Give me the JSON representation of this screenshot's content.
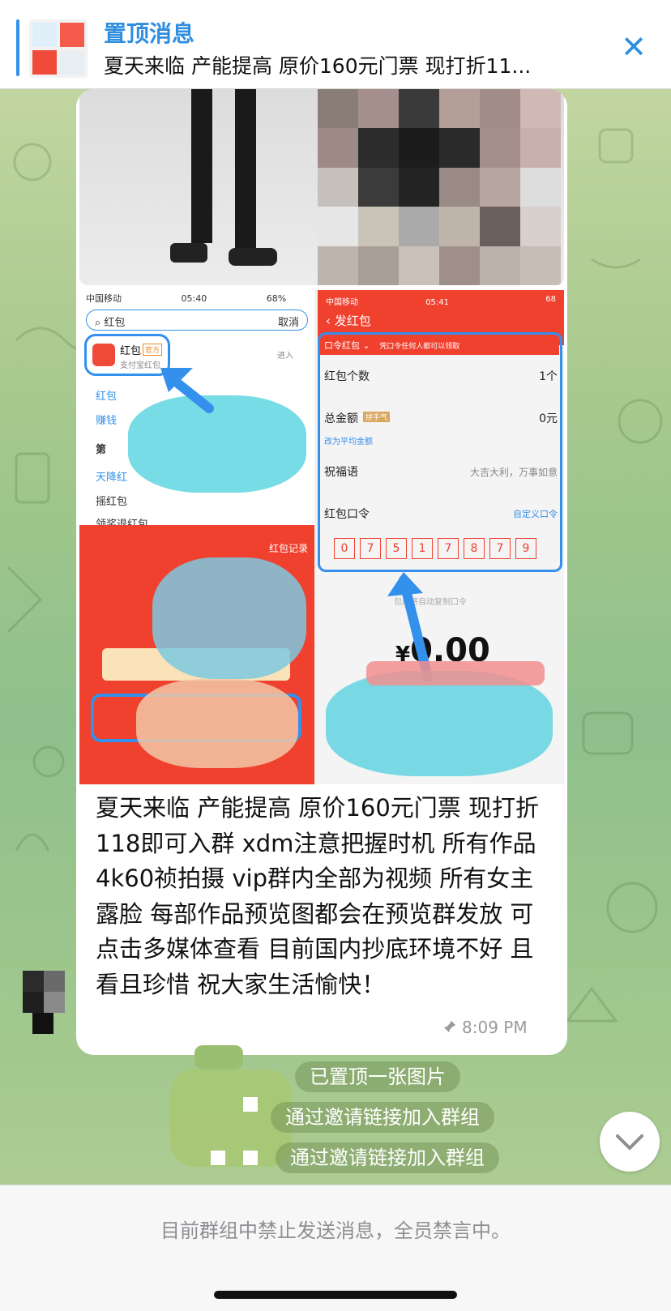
{
  "pinned": {
    "title": "置顶消息",
    "text": "夏天来临 产能提高 原价160元门票 现打折11..."
  },
  "icons": {
    "close": "close-icon",
    "pin": "pin-icon",
    "scroll_down": "chevron-down-icon"
  },
  "album": {
    "left_screenshot": {
      "status_carrier": "中国移动",
      "status_time": "05:40",
      "status_battery": "68%",
      "search_value": "红包",
      "cancel_label": "取消",
      "result_title": "红包",
      "result_badge": "官方",
      "result_sub": "支付宝红包",
      "result_action": "进入",
      "rows": [
        "红包",
        "赚钱",
        "第",
        "天降红",
        "摇红包",
        "领奖退红包"
      ],
      "records_label": "红包记录"
    },
    "right_screenshot": {
      "status_carrier": "中国移动",
      "status_time": "05:41",
      "status_battery": "68",
      "title": "发红包",
      "mode": "口令红包",
      "mode_hint": "凭口令任何人都可以领取",
      "count_label": "红包个数",
      "count_value": "1个",
      "amount_label": "总金额",
      "amount_badge": "拼手气",
      "amount_value": "0元",
      "switch_label": "改为平均金额",
      "blessing_label": "祝福语",
      "blessing_value": "大吉大利，万事如意",
      "code_label": "红包口令",
      "code_custom": "自定义口令",
      "codes": [
        "0",
        "7",
        "5",
        "1",
        "7",
        "8",
        "7",
        "9"
      ],
      "copy_hint": "包后将自动复制口令",
      "currency": "¥",
      "total": "0.00"
    },
    "caption": "夏天来临 产能提高 原价160元门票 现打折118即可入群 xdm注意把握时机 所有作品4k60祯拍摄 vip群内全部为视频 所有女主露脸 每部作品预览图都会在预览群发放 可点击多媒体查看 目前国内抄底环境不好 且看且珍惜 祝大家生活愉快！",
    "time": "8:09 PM"
  },
  "service_messages": [
    "已置顶一张图片",
    "通过邀请链接加入群组",
    "通过邀请链接加入群组"
  ],
  "footer": {
    "muted_notice": "目前群组中禁止发送消息，全员禁言中。"
  },
  "colors": {
    "accent": "#3390ec",
    "red_packet": "#f0412f"
  }
}
